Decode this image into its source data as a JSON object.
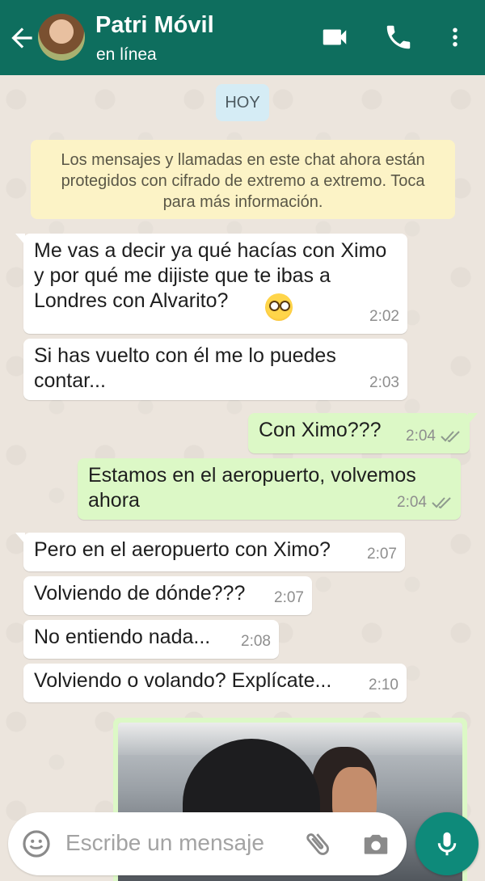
{
  "header": {
    "contact_name": "Patri Móvil",
    "status": "en línea",
    "icons": [
      "back-arrow-icon",
      "video-call-icon",
      "phone-icon",
      "more-vert-icon"
    ],
    "color": "#0e6e5e"
  },
  "chat": {
    "date_label": "HOY",
    "encryption_notice": "Los mensajes y llamadas en este chat ahora están protegidos con cifrado de extremo a extremo. Toca para más información.",
    "messages": [
      {
        "direction": "in",
        "text": "Me vas a decir ya qué hacías con Ximo y por qué me dijiste que te ibas a Londres con Alvarito?",
        "emoji": "face-with-rolling-eyes",
        "time": "2:02"
      },
      {
        "direction": "in",
        "text": "Si has vuelto con él me lo puedes contar...",
        "time": "2:03"
      },
      {
        "direction": "out",
        "text": "Con Ximo???",
        "time": "2:04",
        "status": "double-check"
      },
      {
        "direction": "out",
        "text": "Estamos en el aeropuerto, volvemos ahora",
        "time": "2:04",
        "status": "double-check"
      },
      {
        "direction": "in",
        "text": "Pero en el aeropuerto con Ximo?",
        "time": "2:07"
      },
      {
        "direction": "in",
        "text": "Volviendo de dónde???",
        "time": "2:07"
      },
      {
        "direction": "in",
        "text": "No entiendo nada...",
        "time": "2:08"
      },
      {
        "direction": "in",
        "text": "Volviendo o volando? Explícate...",
        "time": "2:10"
      }
    ],
    "photo_message": {
      "direction": "out",
      "content": "selfie photo"
    }
  },
  "composer": {
    "placeholder": "Escribe un mensaje",
    "icons": [
      "emoji-icon",
      "attach-icon",
      "camera-icon",
      "mic-icon"
    ]
  },
  "colors": {
    "incoming_bubble": "#ffffff",
    "outgoing_bubble": "#dcf8c6",
    "chat_background": "#ece5dd",
    "notice_background": "#fcf3c6",
    "mic_button": "#0e8a7a"
  }
}
